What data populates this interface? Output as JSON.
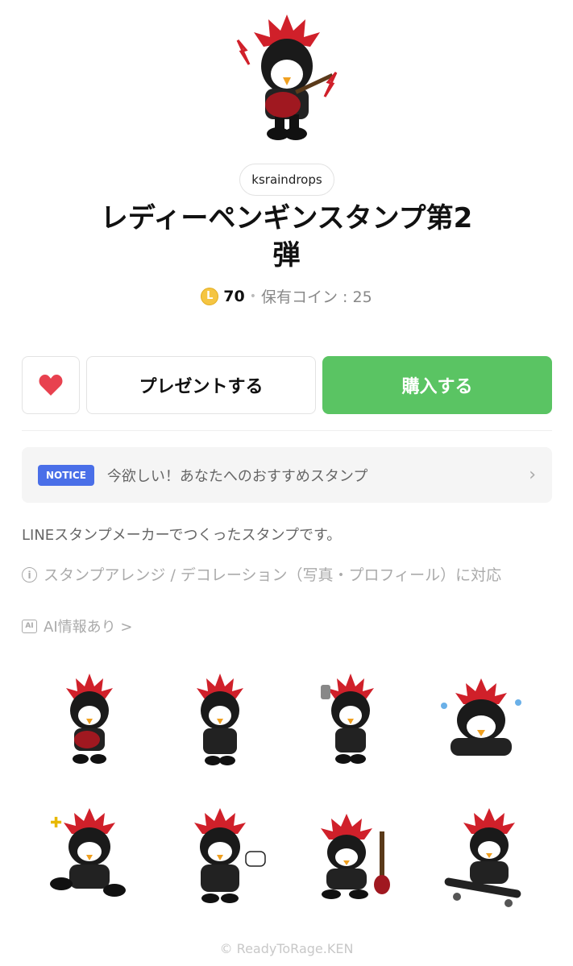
{
  "creator": "ksraindrops",
  "title_line1": "レディーペンギンスタンプ第2",
  "title_line2": "弾",
  "coin_icon": "L",
  "price": "70",
  "owned_coins": "保有コイン : 25",
  "buttons": {
    "gift": "プレゼントする",
    "buy": "購入する"
  },
  "notice": {
    "badge": "NOTICE",
    "text": "今欲しい！あなたへのおすすめスタンプ"
  },
  "description": "LINEスタンプメーカーでつくったスタンプです。",
  "arrange_text": "スタンプアレンジ / デコレーション（写真・プロフィール）に対応",
  "ai_icon": "AI",
  "ai_text": "AI情報あり >",
  "copyright": "© ReadyToRage.KEN",
  "colors": {
    "accent_green": "#5ac463",
    "notice_blue": "#4a6fe8",
    "heart_red": "#e8414f"
  }
}
